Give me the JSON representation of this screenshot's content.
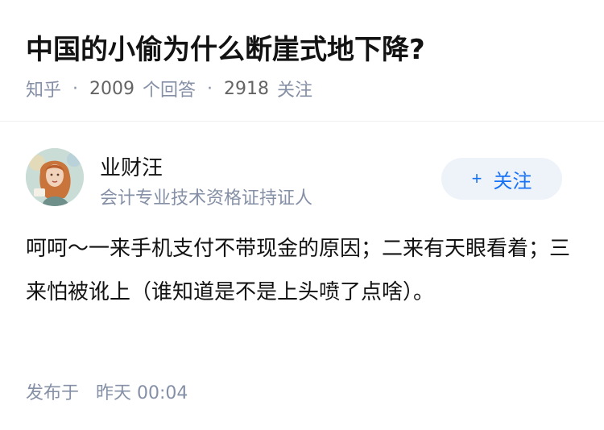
{
  "question": {
    "title": "中国的小偷为什么断崖式地下降?",
    "source": "知乎",
    "answer_count": "2009",
    "answer_label": "个回答",
    "follower_count": "2918",
    "follower_label": "关注"
  },
  "answer": {
    "author": {
      "name": "业财汪",
      "bio": "会计专业技术资格证持证人",
      "avatar_icon": "avatar-portrait"
    },
    "follow_button": {
      "plus": "+",
      "label": "关注"
    },
    "content": "呵呵～一来手机支付不带现金的原因；二来有天眼看着；三来怕被讹上（谁知道是不是上头喷了点啥）。",
    "publish_label": "发布于",
    "publish_time": "昨天 00:04"
  },
  "colors": {
    "accent": "#1772f6",
    "meta": "#8590a6",
    "button_bg": "#eef3fa"
  }
}
